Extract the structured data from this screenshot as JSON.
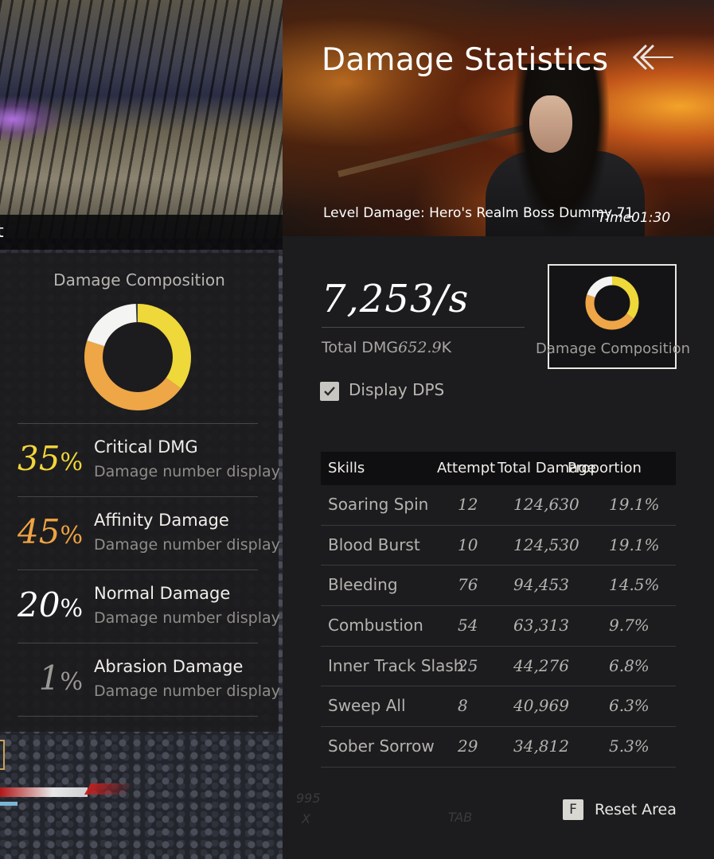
{
  "hud": {
    "tab_text": "t",
    "ghost_number": "995",
    "ghost_x": "X",
    "ghost_tab": "TAB"
  },
  "composition_panel": {
    "title": "Damage Composition",
    "rows": [
      {
        "percent": "35",
        "unit": "%",
        "color": "#f2d53a",
        "name": "Critical DMG",
        "desc": "Damage number displays a"
      },
      {
        "percent": "45",
        "unit": "%",
        "color": "#efa342",
        "name": "Affinity Damage",
        "desc": "Damage number displays a"
      },
      {
        "percent": "20",
        "unit": "%",
        "color": "#ffffff",
        "name": "Normal Damage",
        "desc": "Damage number displays a"
      },
      {
        "percent": "1",
        "unit": "%",
        "color": "#9a9894",
        "name": "Abrasion Damage",
        "desc": "Damage number displays a"
      }
    ]
  },
  "header": {
    "title": "Damage Statistics",
    "level_damage": "Level Damage: Hero's Realm Boss Dummy 71",
    "time_label": "Time",
    "time_value": "01:30"
  },
  "stats": {
    "dps": "7,253/s",
    "total_label": "Total DMG",
    "total_value": "652.9",
    "total_unit": "K",
    "composition_card_label": "Damage Composition",
    "display_dps_label": "Display DPS",
    "display_dps_checked": true
  },
  "table": {
    "headers": {
      "skills": "Skills",
      "attempt": "Attempt",
      "total": "Total Damage",
      "proportion": "Proportion"
    },
    "rows": [
      {
        "skill": "Soaring Spin",
        "attempt": "12",
        "total": "124,630",
        "proportion": "19.1%"
      },
      {
        "skill": "Blood Burst",
        "attempt": "10",
        "total": "124,530",
        "proportion": "19.1%"
      },
      {
        "skill": "Bleeding",
        "attempt": "76",
        "total": "94,453",
        "proportion": "14.5%"
      },
      {
        "skill": "Combustion",
        "attempt": "54",
        "total": "63,313",
        "proportion": "9.7%"
      },
      {
        "skill": "Inner Track Slash",
        "attempt": "25",
        "total": "44,276",
        "proportion": "6.8%"
      },
      {
        "skill": "Sweep All",
        "attempt": "8",
        "total": "40,969",
        "proportion": "6.3%"
      },
      {
        "skill": "Sober Sorrow",
        "attempt": "29",
        "total": "34,812",
        "proportion": "5.3%"
      }
    ]
  },
  "footer": {
    "key": "F",
    "reset_label": "Reset Area"
  },
  "colors": {
    "critical": "#f2d53a",
    "affinity": "#efa342",
    "normal": "#ffffff"
  }
}
